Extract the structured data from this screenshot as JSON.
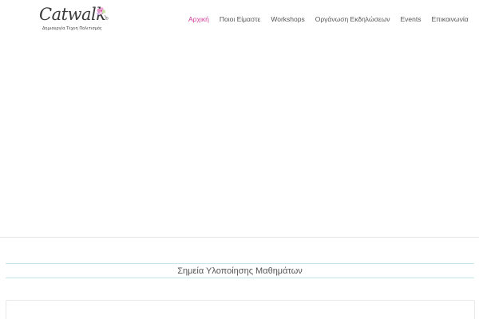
{
  "brand": {
    "name": "Catwalk",
    "tagline": "Δημιουργία Τέχνη Πολιτισμός",
    "icon": "flower-logo-icon",
    "accent_color": "#d23b97"
  },
  "nav": {
    "items": [
      {
        "label": "Αρχική",
        "active": true
      },
      {
        "label": "Ποιοι Είμαστε",
        "active": false
      },
      {
        "label": "Workshops",
        "active": false
      },
      {
        "label": "Οργάνωση Εκδηλώσεων",
        "active": false
      },
      {
        "label": "Events",
        "active": false
      },
      {
        "label": "Επικοινωνία",
        "active": false
      }
    ]
  },
  "section": {
    "title": "Σημεία Υλοποίησης Μαθημάτων"
  }
}
